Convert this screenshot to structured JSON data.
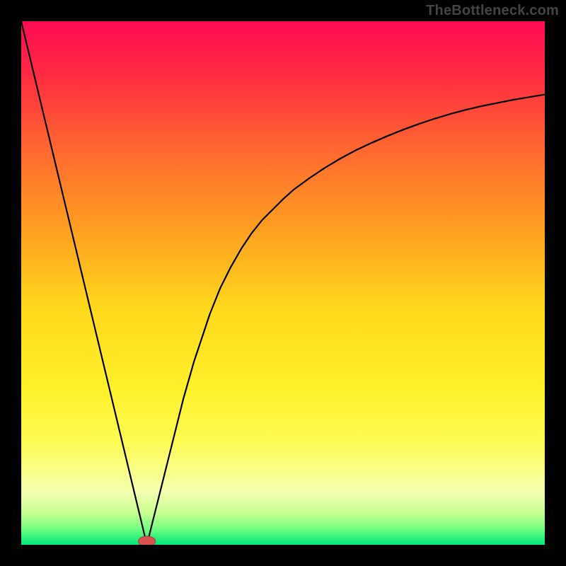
{
  "watermark": "TheBottleneck.com",
  "chart_data": {
    "type": "line",
    "title": "",
    "xlabel": "",
    "ylabel": "",
    "xlim": [
      0,
      100
    ],
    "ylim": [
      0,
      100
    ],
    "grid": false,
    "x": [
      0,
      1,
      2,
      3,
      4,
      5,
      6,
      7,
      8,
      9,
      10,
      11,
      12,
      13,
      14,
      15,
      16,
      17,
      18,
      19,
      20,
      21,
      22,
      23,
      24,
      25,
      26,
      27,
      28,
      29,
      30,
      31,
      32,
      33,
      34,
      35,
      36,
      37,
      38,
      39,
      40,
      42,
      44,
      46,
      48,
      50,
      52,
      55,
      58,
      61,
      64,
      67,
      70,
      73,
      76,
      79,
      82,
      85,
      88,
      91,
      94,
      97,
      100
    ],
    "values": [
      100,
      95.83,
      91.67,
      87.5,
      83.33,
      79.17,
      75,
      70.83,
      66.67,
      62.5,
      58.33,
      54.17,
      50,
      45.83,
      41.67,
      37.5,
      33.33,
      29.17,
      25,
      20.83,
      16.67,
      12.5,
      8.33,
      4.17,
      0,
      4,
      8,
      12,
      16,
      20,
      24,
      28,
      31.5,
      35,
      38,
      41,
      44,
      46.5,
      49,
      51,
      53,
      56.5,
      59.5,
      62,
      64,
      66,
      67.8,
      70,
      72,
      73.8,
      75.4,
      76.8,
      78.1,
      79.3,
      80.4,
      81.4,
      82.3,
      83.1,
      83.8,
      84.4,
      85,
      85.5,
      86
    ],
    "marker": {
      "x": 24,
      "y": 0,
      "color_fill": "#d9534f",
      "color_stroke": "#a94442",
      "rx": 12,
      "ry": 7
    },
    "gradient_stops": [
      {
        "offset": 0.0,
        "color": "#ff0b54"
      },
      {
        "offset": 0.1,
        "color": "#ff2a42"
      },
      {
        "offset": 0.25,
        "color": "#ff6a2f"
      },
      {
        "offset": 0.4,
        "color": "#ffa021"
      },
      {
        "offset": 0.55,
        "color": "#ffd91c"
      },
      {
        "offset": 0.7,
        "color": "#fff02a"
      },
      {
        "offset": 0.8,
        "color": "#fdfb52"
      },
      {
        "offset": 0.86,
        "color": "#faff8a"
      },
      {
        "offset": 0.9,
        "color": "#f2ffb0"
      },
      {
        "offset": 0.94,
        "color": "#c6ff90"
      },
      {
        "offset": 0.97,
        "color": "#70ff80"
      },
      {
        "offset": 1.0,
        "color": "#00e67a"
      }
    ],
    "line_color": "#000000",
    "line_width": 2.2
  }
}
